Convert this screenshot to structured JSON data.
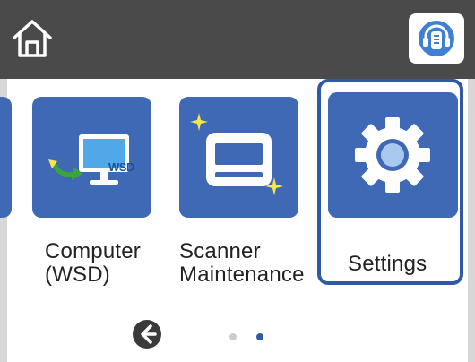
{
  "header": {
    "home_icon": "home-icon",
    "help_icon": "help-icon"
  },
  "apps": [
    {
      "label_line1": "Computer",
      "label_line2": "(WSD)",
      "icon": "computer-wsd-icon",
      "badge": "WSD"
    },
    {
      "label_line1": "Scanner",
      "label_line2": "Maintenance",
      "icon": "scanner-icon"
    },
    {
      "label_line1": "Settings",
      "icon": "gear-icon",
      "selected": true
    }
  ],
  "pagination": {
    "back_icon": "arrow-left-icon",
    "pages": 2,
    "current": 2
  },
  "colors": {
    "topbar": "#4a4a4a",
    "tile": "#3f68b5",
    "selection": "#2f5aa3",
    "accent_green": "#3aa63a",
    "accent_yellow": "#f5e64a"
  }
}
